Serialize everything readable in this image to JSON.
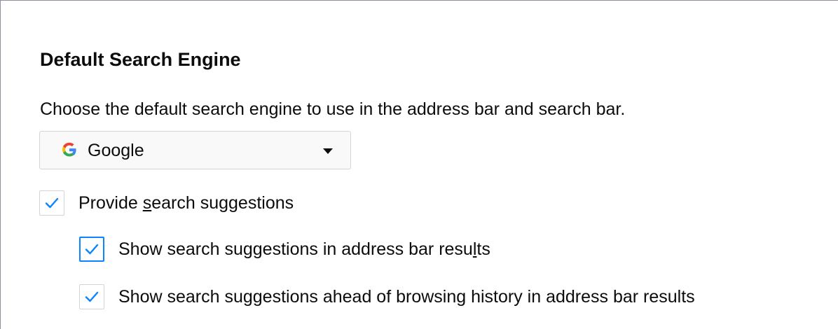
{
  "section": {
    "title": "Default Search Engine",
    "description": "Choose the default search engine to use in the address bar and search bar."
  },
  "engine_select": {
    "icon": "google-g-icon",
    "selected": "Google",
    "brand_colors": {
      "blue": "#4285F4",
      "red": "#EA4335",
      "yellow": "#FBBC05",
      "green": "#34A853"
    }
  },
  "options": [
    {
      "label_before": "Provide ",
      "label_accesskey": "s",
      "label_after": "earch suggestions",
      "checked": true
    },
    {
      "label_before": "Show search suggestions in address bar resu",
      "label_accesskey": "l",
      "label_after": "ts",
      "checked": true,
      "focused": true
    },
    {
      "label_before": "Show search suggestions ahead of browsing history in address bar results",
      "label_accesskey": "",
      "label_after": "",
      "checked": true
    }
  ],
  "colors": {
    "accent": "#0A84FF",
    "text": "#0C0C0D",
    "border": "#D4D4D6"
  }
}
